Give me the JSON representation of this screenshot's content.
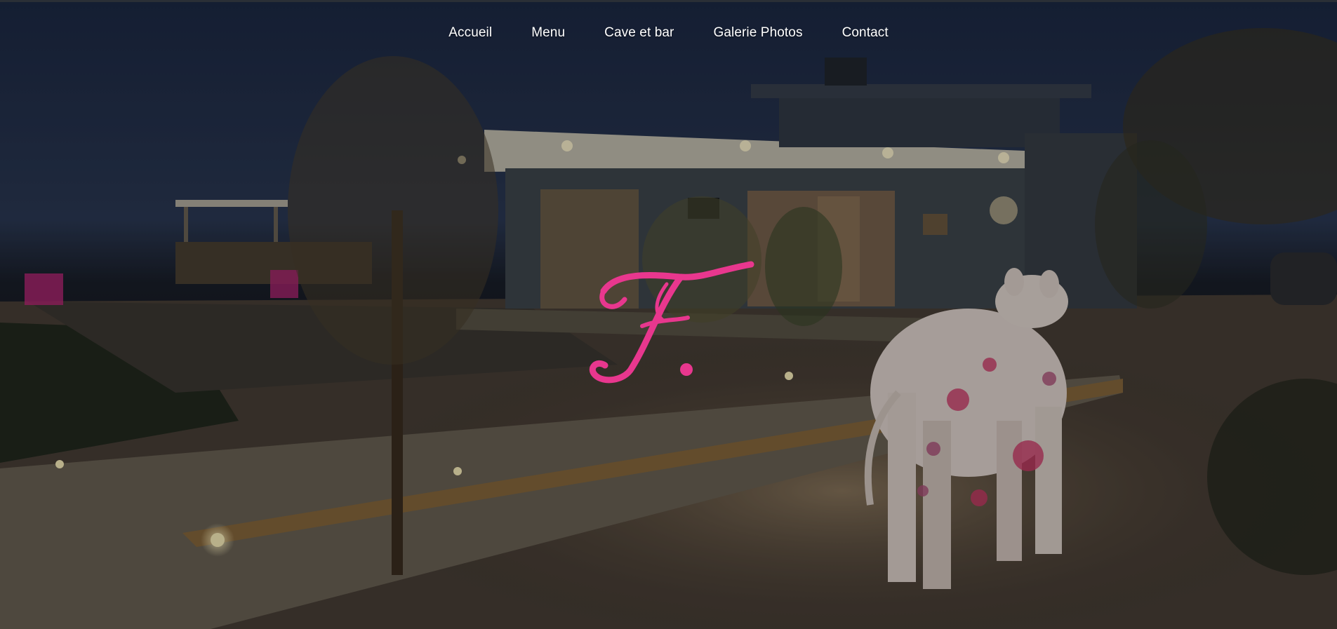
{
  "nav": {
    "items": [
      {
        "label": "Accueil"
      },
      {
        "label": "Menu"
      },
      {
        "label": "Cave et bar"
      },
      {
        "label": "Galerie Photos"
      },
      {
        "label": "Contact"
      }
    ]
  },
  "hero": {
    "logo_letter": "F",
    "logo_color": "#e8378e"
  },
  "colors": {
    "sky": "#1e2a44",
    "nav_text": "#ffffff",
    "accent": "#e8378e"
  },
  "icons": [
    "restaurant-logo-icon",
    "cow-statue-image"
  ]
}
